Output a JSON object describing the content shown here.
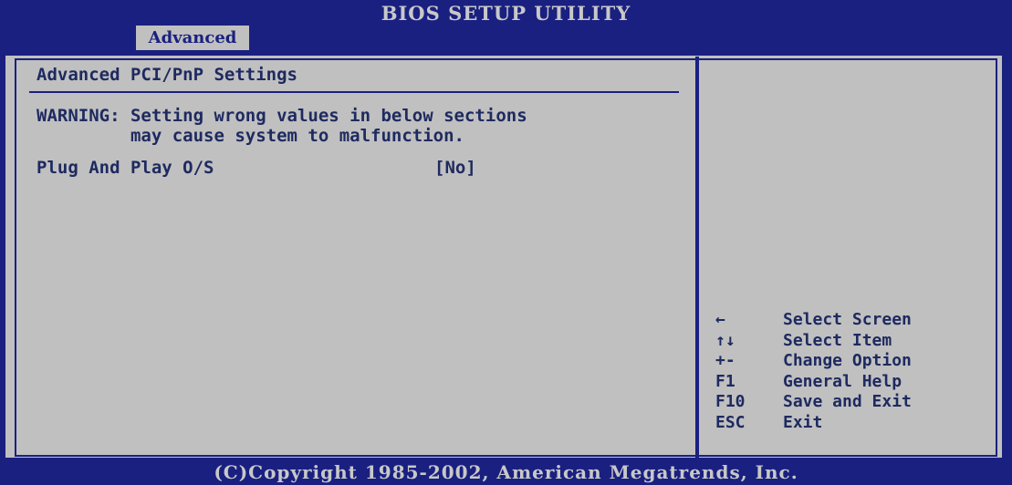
{
  "header": {
    "title": "BIOS SETUP UTILITY",
    "active_tab": "Advanced"
  },
  "main": {
    "page_title": "Advanced PCI/PnP Settings",
    "warning_line1": "WARNING: Setting wrong values in below sections",
    "warning_line2": "         may cause system to malfunction.",
    "settings": [
      {
        "label": "Plug And Play O/S",
        "value": "[No]"
      }
    ]
  },
  "help": {
    "items": [
      {
        "key": "←",
        "key_icon": "arrow-left-icon",
        "desc": "Select Screen"
      },
      {
        "key": "↑↓",
        "key_icon": "arrow-up-down-icon",
        "desc": "Select Item"
      },
      {
        "key": "+-",
        "desc": "Change Option"
      },
      {
        "key": "F1",
        "desc": "General Help"
      },
      {
        "key": "F10",
        "desc": "Save and Exit"
      },
      {
        "key": "ESC",
        "desc": "Exit"
      }
    ]
  },
  "footer": {
    "copyright": "(C)Copyright 1985-2002, American Megatrends, Inc."
  },
  "colors": {
    "background_blue": "#1a2080",
    "panel_gray": "#c0c0c0",
    "text_navy": "#1e2a60",
    "header_text": "#c8c8c8"
  }
}
